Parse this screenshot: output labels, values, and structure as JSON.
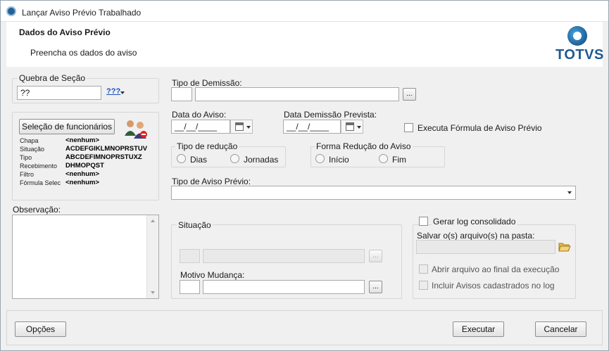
{
  "window": {
    "title": "Lançar Aviso Prévio Trabalhado",
    "icon": "totvs-app-icon"
  },
  "header": {
    "title": "Dados do Aviso Prévio",
    "subtitle": "Preencha os dados do aviso",
    "logo_text": "TOTVS"
  },
  "quebra": {
    "label": "Quebra de Seção",
    "value": "??",
    "lookup_label": "???"
  },
  "selecao": {
    "button_label": "Seleção de funcionários",
    "icon": "users-icon",
    "rows": [
      {
        "key": "Chapa",
        "value": "<nenhum>"
      },
      {
        "key": "Situação",
        "value": "ACDEFGIKLMNOPRSTUV"
      },
      {
        "key": "Tipo",
        "value": "ABCDEFIMNOPRSTUXZ"
      },
      {
        "key": "Recebimento",
        "value": "DHMOPQST"
      },
      {
        "key": "Filtro",
        "value": "<nenhum>"
      },
      {
        "key": "Fórmula Selec",
        "value": "<nenhum>"
      }
    ]
  },
  "observacao": {
    "label": "Observação:",
    "value": ""
  },
  "tipo_demissao": {
    "label": "Tipo de Demissão:",
    "code": "",
    "desc": "",
    "button": "..."
  },
  "data_aviso": {
    "label": "Data do Aviso:",
    "value": "__/__/____"
  },
  "data_demissao": {
    "label": "Data Demissão Prevista:",
    "value": "__/__/____"
  },
  "executa_formula": {
    "label": "Executa Fórmula de Aviso Prévio",
    "checked": false
  },
  "tipo_reducao": {
    "label": "Tipo de redução",
    "options": [
      "Dias",
      "Jornadas"
    ]
  },
  "forma_reducao": {
    "label": "Forma Redução do Aviso",
    "options": [
      "Início",
      "Fim"
    ]
  },
  "tipo_aviso": {
    "label": "Tipo de Aviso Prévio:",
    "value": ""
  },
  "situacao": {
    "label": "Situação",
    "code": "",
    "desc": "",
    "button": "...",
    "motivo_label": "Motivo Mudança:",
    "motivo_code": "",
    "motivo_desc": "",
    "motivo_button": "..."
  },
  "log": {
    "gerar_label": "Gerar log consolidado",
    "pasta_label": "Salvar o(s) arquivo(s) na pasta:",
    "pasta_value": "",
    "folder_icon": "folder-open-icon",
    "abrir_label": "Abrir arquivo ao final da execução",
    "incluir_label": "Incluir Avisos cadastrados no log"
  },
  "footer": {
    "opcoes": "Opções",
    "executar": "Executar",
    "cancelar": "Cancelar"
  }
}
